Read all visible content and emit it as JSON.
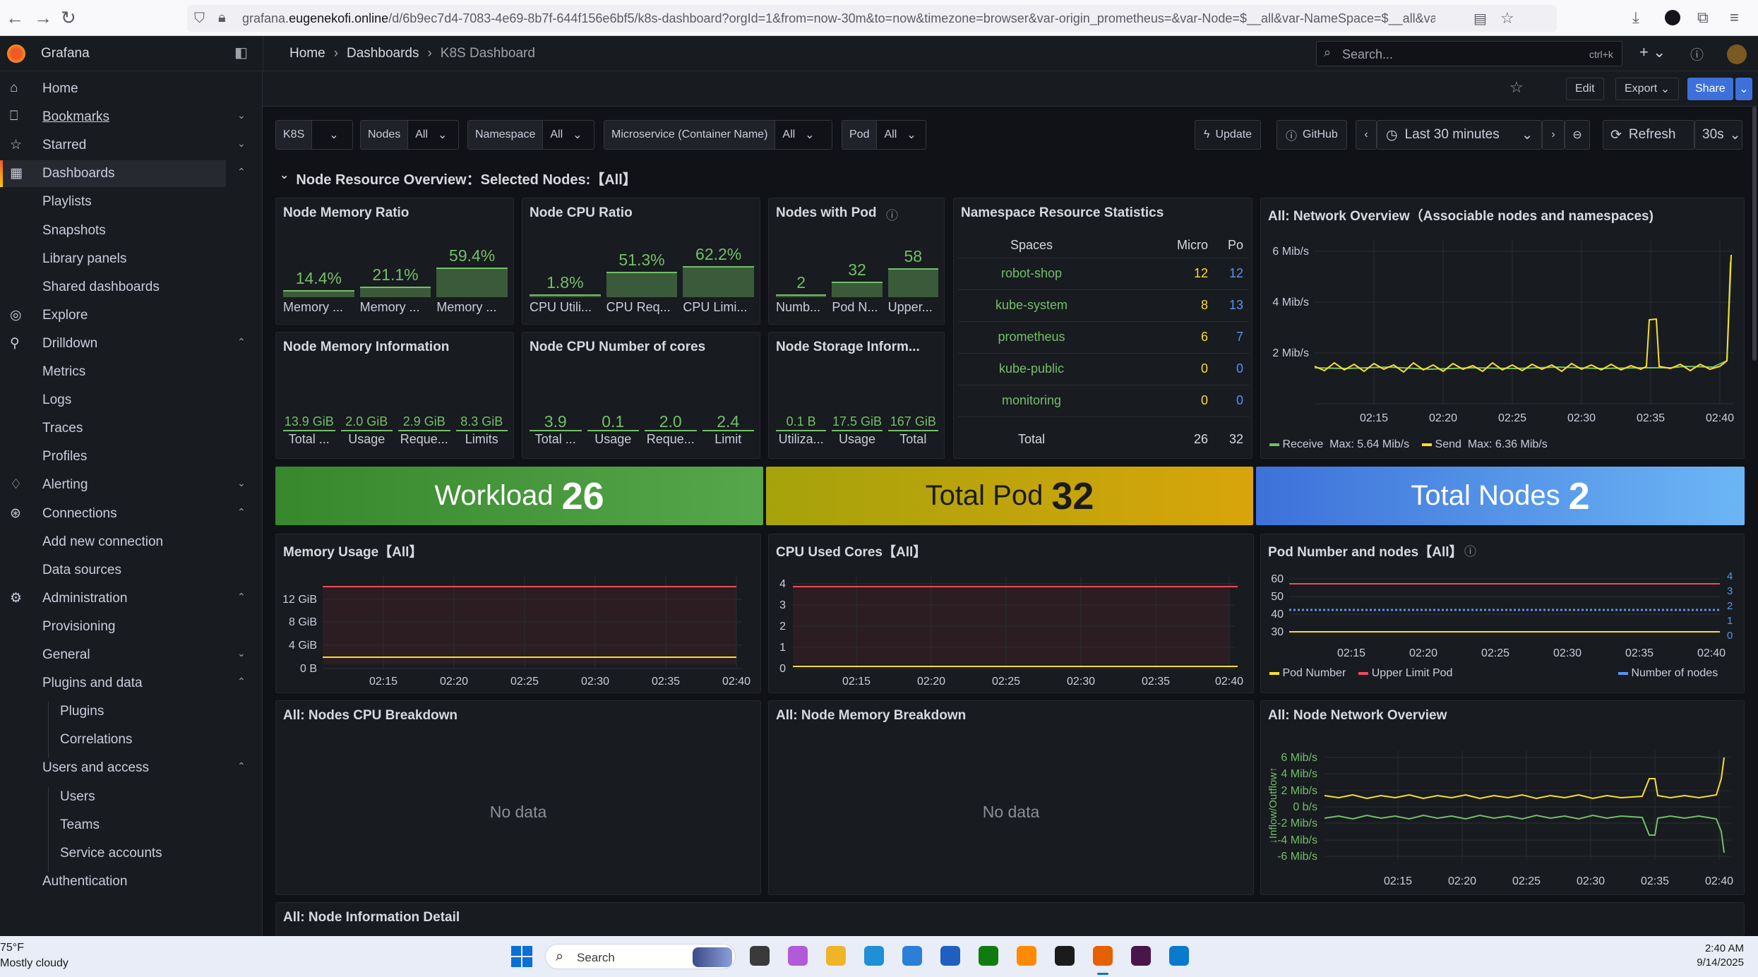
{
  "browser": {
    "url_prefix": "grafana.",
    "url_domain": "eugenekofi.online",
    "url_rest": "/d/6b9ec7d4-7083-4e69-8b7f-644f156e6bf5/k8s-dashboard?orgId=1&from=now-30m&to=now&timezone=browser&var-origin_prometheus=&var-Node=$__all&var-NameSpace=$__all&var-Container"
  },
  "app": {
    "name": "Grafana"
  },
  "breadcrumb": [
    "Home",
    "Dashboards",
    "K8S Dashboard"
  ],
  "search": {
    "placeholder": "Search...",
    "shortcut": "ctrl+k"
  },
  "toolbar": {
    "edit": "Edit",
    "export": "Export",
    "share": "Share"
  },
  "sidebar": [
    {
      "label": "Home",
      "icon": "home-icon",
      "level": 0
    },
    {
      "label": "Bookmarks",
      "icon": "bookmark-icon",
      "level": 0,
      "chev": "v"
    },
    {
      "label": "Starred",
      "icon": "star-icon",
      "level": 0,
      "chev": "v"
    },
    {
      "label": "Dashboards",
      "icon": "dashboards-icon",
      "level": 0,
      "chev": "^",
      "active": true
    },
    {
      "label": "Playlists",
      "level": 1
    },
    {
      "label": "Snapshots",
      "level": 1
    },
    {
      "label": "Library panels",
      "level": 1
    },
    {
      "label": "Shared dashboards",
      "level": 1
    },
    {
      "label": "Explore",
      "icon": "compass-icon",
      "level": 0
    },
    {
      "label": "Drilldown",
      "icon": "drilldown-icon",
      "level": 0,
      "chev": "^"
    },
    {
      "label": "Metrics",
      "level": 1
    },
    {
      "label": "Logs",
      "level": 1
    },
    {
      "label": "Traces",
      "level": 1
    },
    {
      "label": "Profiles",
      "level": 1
    },
    {
      "label": "Alerting",
      "icon": "bell-icon",
      "level": 0,
      "chev": "v"
    },
    {
      "label": "Connections",
      "icon": "connections-icon",
      "level": 0,
      "chev": "^"
    },
    {
      "label": "Add new connection",
      "level": 1
    },
    {
      "label": "Data sources",
      "level": 1
    },
    {
      "label": "Administration",
      "icon": "gear-icon",
      "level": 0,
      "chev": "^"
    },
    {
      "label": "Provisioning",
      "level": 1
    },
    {
      "label": "General",
      "level": 1,
      "chev": "v"
    },
    {
      "label": "Plugins and data",
      "level": 1,
      "chev": "^"
    },
    {
      "label": "Plugins",
      "level": 2
    },
    {
      "label": "Correlations",
      "level": 2
    },
    {
      "label": "Users and access",
      "level": 1,
      "chev": "^"
    },
    {
      "label": "Users",
      "level": 2
    },
    {
      "label": "Teams",
      "level": 2
    },
    {
      "label": "Service accounts",
      "level": 2
    },
    {
      "label": "Authentication",
      "level": 1
    }
  ],
  "variables": [
    {
      "label": "K8S",
      "value": ""
    },
    {
      "label": "Nodes",
      "value": "All"
    },
    {
      "label": "Namespace",
      "value": "All"
    },
    {
      "label": "Microservice (Container Name)",
      "value": "All"
    },
    {
      "label": "Pod",
      "value": "All"
    }
  ],
  "links": {
    "update": "Update",
    "github": "GitHub"
  },
  "timepicker": {
    "range": "Last 30 minutes",
    "refresh": "Refresh",
    "interval": "30s"
  },
  "row_title": "Node Resource Overview：Selected Nodes:【All】",
  "panels": {
    "mem_ratio": {
      "title": "Node Memory Ratio",
      "items": [
        {
          "value": "14.4%",
          "label": "Memory ...",
          "fill": 0.144
        },
        {
          "value": "21.1%",
          "label": "Memory ...",
          "fill": 0.211
        },
        {
          "value": "59.4%",
          "label": "Memory ...",
          "fill": 0.594
        }
      ]
    },
    "cpu_ratio": {
      "title": "Node CPU Ratio",
      "items": [
        {
          "value": "1.8%",
          "label": "CPU Utili...",
          "fill": 0.018
        },
        {
          "value": "51.3%",
          "label": "CPU Req...",
          "fill": 0.513
        },
        {
          "value": "62.2%",
          "label": "CPU Limi...",
          "fill": 0.622
        }
      ]
    },
    "nodes_pod": {
      "title": "Nodes with Pod",
      "items": [
        {
          "value": "2",
          "label": "Numb...",
          "fill": 0.02
        },
        {
          "value": "32",
          "label": "Pod N...",
          "fill": 0.32
        },
        {
          "value": "58",
          "label": "Upper...",
          "fill": 0.58
        }
      ]
    },
    "mem_info": {
      "title": "Node Memory Information",
      "items": [
        {
          "value": "13.9 GiB",
          "label": "Total ..."
        },
        {
          "value": "2.0 GiB",
          "label": "Usage"
        },
        {
          "value": "2.9 GiB",
          "label": "Reque..."
        },
        {
          "value": "8.3 GiB",
          "label": "Limits"
        }
      ]
    },
    "cpu_cores": {
      "title": "Node CPU Number of cores",
      "items": [
        {
          "value": "3.9",
          "label": "Total ..."
        },
        {
          "value": "0.1",
          "label": "Usage"
        },
        {
          "value": "2.0",
          "label": "Reque..."
        },
        {
          "value": "2.4",
          "label": "Limit"
        }
      ]
    },
    "storage": {
      "title": "Node Storage Inform...",
      "items": [
        {
          "value": "0.1 B",
          "label": "Utiliza..."
        },
        {
          "value": "17.5 GiB",
          "label": "Usage"
        },
        {
          "value": "167 GiB",
          "label": "Total"
        }
      ]
    },
    "ns_stats": {
      "title": "Namespace Resource Statistics",
      "headers": [
        "Spaces",
        "Micro",
        "Po"
      ],
      "rows": [
        [
          "robot-shop",
          "12",
          "12"
        ],
        [
          "kube-system",
          "8",
          "13"
        ],
        [
          "prometheus",
          "6",
          "7"
        ],
        [
          "kube-public",
          "0",
          "0"
        ],
        [
          "monitoring",
          "0",
          "0"
        ]
      ],
      "total": [
        "Total",
        "26",
        "32"
      ]
    },
    "net_overview": {
      "title": "All:  Network Overview（Associable nodes and namespaces)",
      "legend": [
        {
          "name": "Receive",
          "extra": "Max: 5.64 Mib/s",
          "color": "#73bf69"
        },
        {
          "name": "Send",
          "extra": "Max: 6.36 Mib/s",
          "color": "#fade2a"
        }
      ]
    },
    "workload": {
      "label": "Workload",
      "value": "26"
    },
    "total_pod": {
      "label": "Total Pod",
      "value": "32"
    },
    "total_nodes": {
      "label": "Total Nodes",
      "value": "2"
    },
    "mem_usage": {
      "title": "Memory Usage【All】"
    },
    "cpu_used": {
      "title": "CPU Used Cores【All】"
    },
    "pod_nodes": {
      "title": "Pod Number and nodes【All】",
      "legend": [
        {
          "name": "Pod Number",
          "color": "#fade2a"
        },
        {
          "name": "Upper Limit Pod",
          "color": "#f2495c"
        },
        {
          "name": "Number of nodes",
          "color": "#5794f2"
        }
      ]
    },
    "cpu_breakdown": {
      "title": "All:  Nodes CPU Breakdown",
      "nodata": "No data"
    },
    "mem_breakdown": {
      "title": "All:  Node Memory Breakdown",
      "nodata": "No data"
    },
    "node_net": {
      "title": "All:  Node Network Overview",
      "ylabel": "↓Inflow/Outflow↑"
    },
    "node_detail": {
      "title": "All:  Node Information Detail"
    }
  },
  "chart_data": [
    {
      "type": "line",
      "title": "All:  Network Overview（Associable nodes and namespaces)",
      "x": [
        "02:15",
        "02:20",
        "02:25",
        "02:30",
        "02:35",
        "02:40"
      ],
      "yticks": [
        "2 Mib/s",
        "4 Mib/s",
        "6 Mib/s"
      ],
      "series": [
        {
          "name": "Receive",
          "max": "5.64 Mib/s"
        },
        {
          "name": "Send",
          "max": "6.36 Mib/s"
        }
      ]
    },
    {
      "type": "line",
      "title": "Memory Usage【All】",
      "x": [
        "02:15",
        "02:20",
        "02:25",
        "02:30",
        "02:35",
        "02:40"
      ],
      "yticks": [
        "0 B",
        "4 GiB",
        "8 GiB",
        "12 GiB"
      ],
      "series": [
        {
          "values_gib": [
            13.9,
            13.9
          ]
        },
        {
          "values_gib": [
            2.0,
            2.0
          ]
        }
      ]
    },
    {
      "type": "line",
      "title": "CPU Used Cores【All】",
      "x": [
        "02:15",
        "02:20",
        "02:25",
        "02:30",
        "02:35",
        "02:40"
      ],
      "yticks": [
        "0",
        "1",
        "2",
        "3",
        "4"
      ],
      "series": [
        {
          "values": [
            3.9,
            3.9
          ]
        },
        {
          "values": [
            0.1,
            0.1
          ]
        }
      ]
    },
    {
      "type": "line",
      "title": "Pod Number and nodes【All】",
      "x": [
        "02:15",
        "02:20",
        "02:25",
        "02:30",
        "02:35",
        "02:40"
      ],
      "yticks_left": [
        "30",
        "40",
        "50",
        "60"
      ],
      "yticks_right": [
        "0",
        "1",
        "2",
        "3",
        "4"
      ],
      "series": [
        {
          "name": "Pod Number",
          "value": 32
        },
        {
          "name": "Upper Limit Pod",
          "value": 58
        },
        {
          "name": "Number of nodes",
          "value": 2
        }
      ]
    },
    {
      "type": "line",
      "title": "All:  Node Network Overview",
      "x": [
        "02:15",
        "02:20",
        "02:25",
        "02:30",
        "02:35",
        "02:40"
      ],
      "yticks": [
        "-6 Mib/s",
        "-4 Mib/s",
        "-2 Mib/s",
        "0 b/s",
        "2 Mib/s",
        "4 Mib/s",
        "6 Mib/s"
      ]
    }
  ],
  "taskbar": {
    "weather_temp": "75°F",
    "weather_desc": "Mostly cloudy",
    "search": "Search",
    "time": "2:40 AM",
    "date": "9/14/2025"
  }
}
